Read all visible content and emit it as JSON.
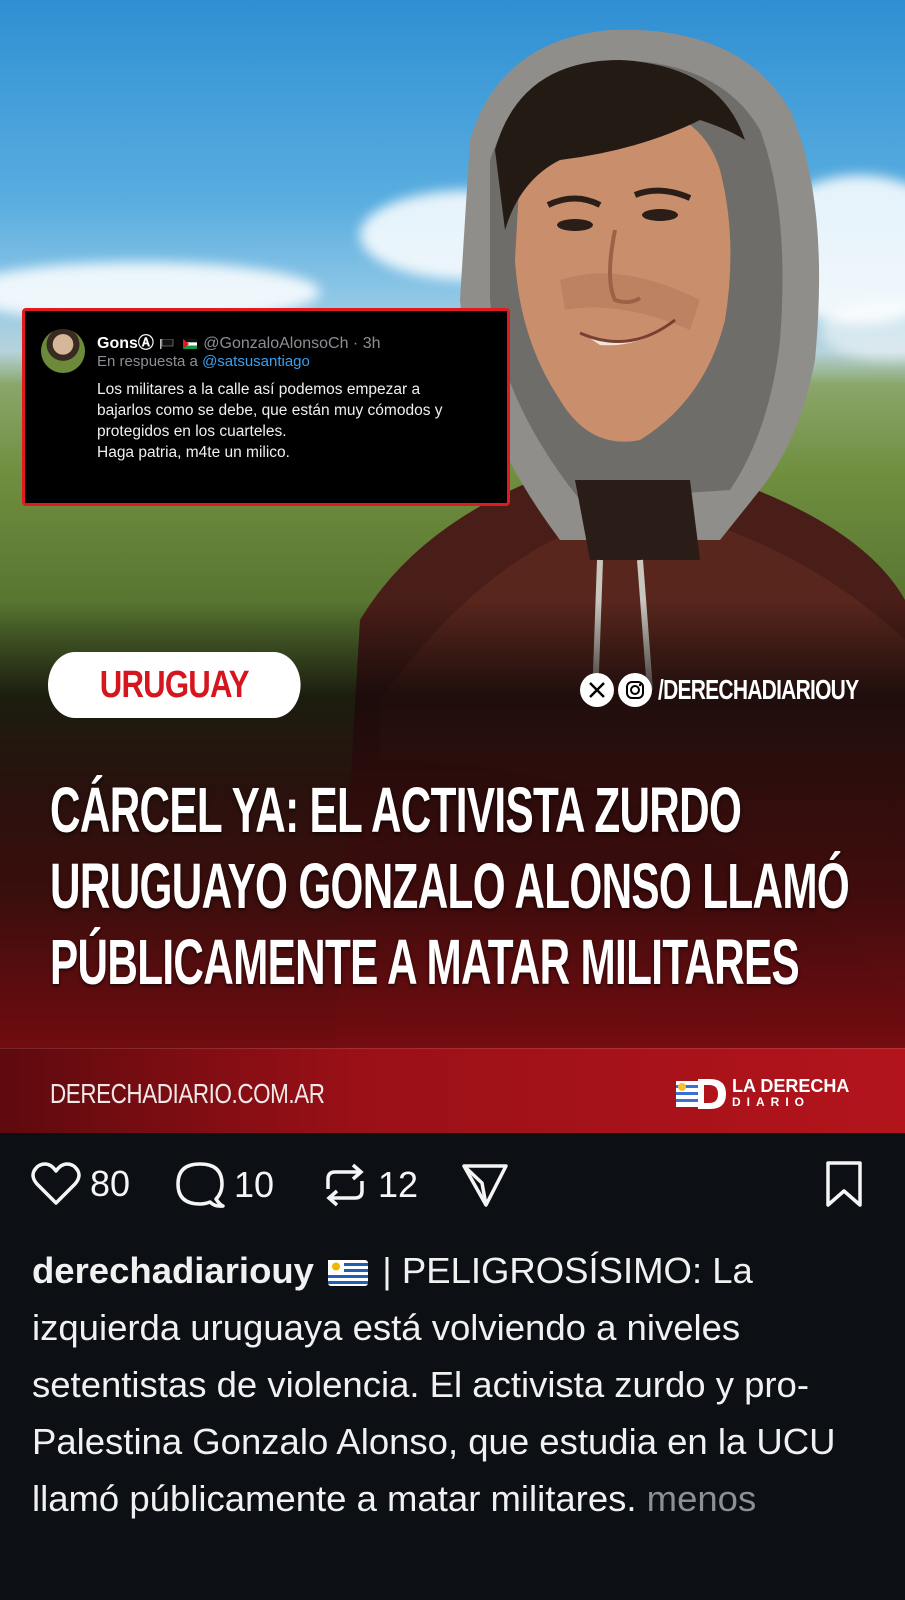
{
  "tweet": {
    "name": "Gons",
    "symbols": "Ⓐ",
    "handle": "@GonzaloAlonsoCh · 3h",
    "reply_prefix": "En respuesta a",
    "reply_mention": "@satsusantiago",
    "body_lines": [
      "Los militares a la calle así podemos empezar a",
      "bajarlos como se debe, que están muy cómodos y",
      "protegidos en los cuarteles.",
      "Haga patria, m4te un milico."
    ]
  },
  "banner": {
    "tag": "URUGUAY",
    "social_handle": "/DERECHADIARIOUY",
    "headline_lines": [
      "CÁRCEL YA: EL ACTIVISTA ZURDO",
      "URUGUAYO GONZALO ALONSO LLAMÓ",
      "PÚBLICAMENTE A MATAR MILITARES"
    ],
    "site_url": "DERECHADIARIO.COM.AR",
    "brand_line1": "LA DERECHA",
    "brand_line2": "DIARIO"
  },
  "actions": {
    "likes": "80",
    "comments": "10",
    "reposts": "12"
  },
  "caption": {
    "username": "derechadiariouy",
    "text": " | PELIGROSÍSIMO: La izquierda uruguaya está volviendo a niveles setentistas de violencia. El activista zurdo y pro-Palestina Gonzalo Alonso, que estudia en la UCU llamó públicamente a matar militares.",
    "more": "menos"
  },
  "colors": {
    "background": "#0c1015",
    "accent_red": "#d5161e",
    "mention_blue": "#3b9ff0",
    "muted": "#8c9096"
  }
}
